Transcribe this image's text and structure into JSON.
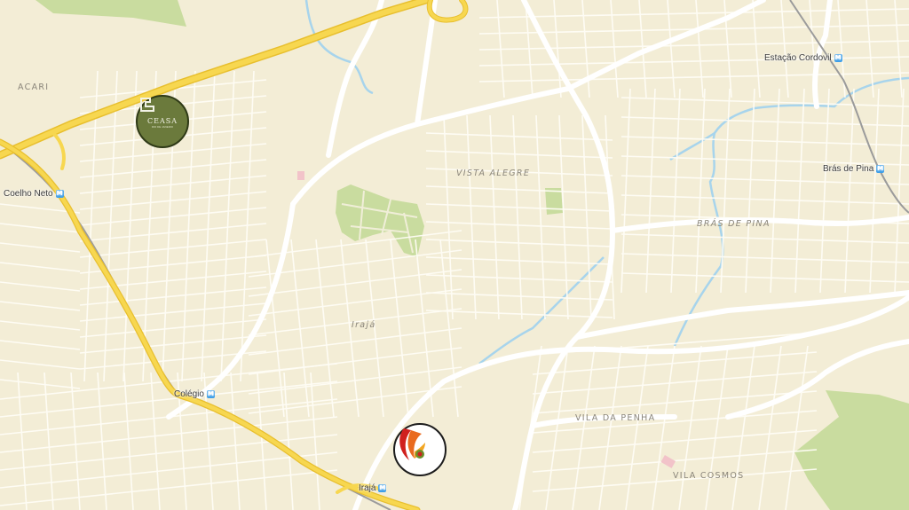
{
  "map": {
    "colors": {
      "land": "#f3edd6",
      "minor_road": "#fffdf6",
      "highway": "#f7d750",
      "highway_edge": "#e8bf2e",
      "park": "#c9dc9f",
      "water": "#a7d4ec",
      "railway": "#9b9b9b"
    },
    "areas": [
      {
        "name": "ACARI"
      },
      {
        "name": "VISTA ALEGRE"
      },
      {
        "name": "BRÁS DE PINA"
      },
      {
        "name": "Irajá"
      },
      {
        "name": "VILA DA PENHA"
      },
      {
        "name": "VILA COSMOS"
      }
    ],
    "stations": [
      {
        "name": "Estação Cordovil",
        "icon": "metro-icon"
      },
      {
        "name": "Brás de Pina",
        "icon": "metro-icon"
      },
      {
        "name": "Coelho Neto",
        "icon": "metro-icon"
      },
      {
        "name": "Colégio",
        "icon": "metro-icon"
      },
      {
        "name": "Irajá",
        "icon": "metro-icon"
      }
    ],
    "metro_symbol": "M",
    "markers": {
      "ceasa": {
        "label": "CEASA",
        "sub": "RIO DE JANEIRO"
      }
    }
  }
}
